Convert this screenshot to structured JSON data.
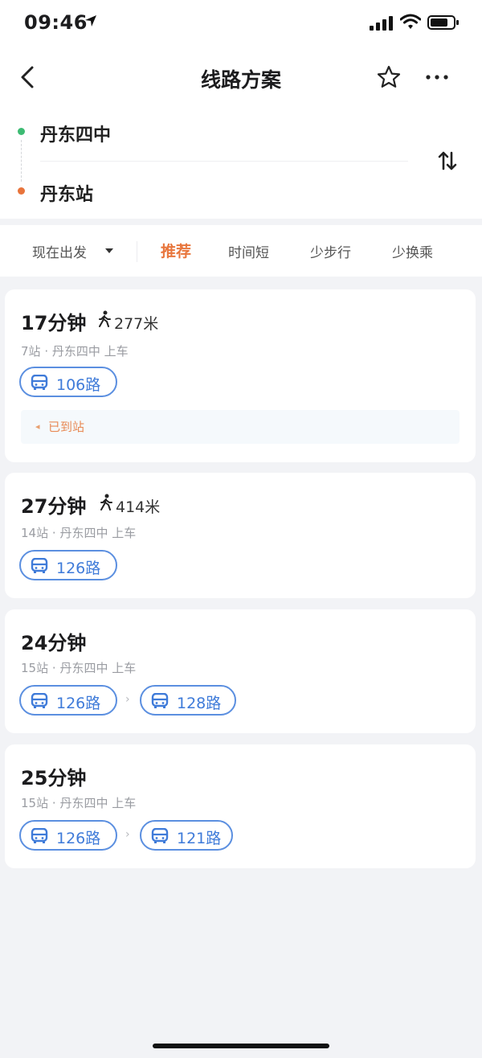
{
  "status_bar": {
    "time": "09:46"
  },
  "nav": {
    "title": "线路方案"
  },
  "route": {
    "start": "丹东四中",
    "end": "丹东站"
  },
  "filters": {
    "depart": "现在出发",
    "options": [
      "推荐",
      "时间短",
      "少步行",
      "少换乘"
    ]
  },
  "colors": {
    "accent": "#e8763d",
    "bus_blue": "#3f7bd9",
    "start_dot": "#3dbb73",
    "end_dot": "#e8743b"
  },
  "routes": [
    {
      "duration": "17分钟",
      "walk": "277米",
      "stops": "7站",
      "board": "丹东四中 上车",
      "buses": [
        "106路"
      ],
      "status": "已到站"
    },
    {
      "duration": "27分钟",
      "walk": "414米",
      "stops": "14站",
      "board": "丹东四中 上车",
      "buses": [
        "126路"
      ]
    },
    {
      "duration": "24分钟",
      "stops": "15站",
      "board": "丹东四中 上车",
      "buses": [
        "126路",
        "128路"
      ]
    },
    {
      "duration": "25分钟",
      "stops": "15站",
      "board": "丹东四中 上车",
      "buses": [
        "126路",
        "121路"
      ]
    }
  ],
  "separators": {
    "dot": "·",
    "chevron": "›"
  }
}
